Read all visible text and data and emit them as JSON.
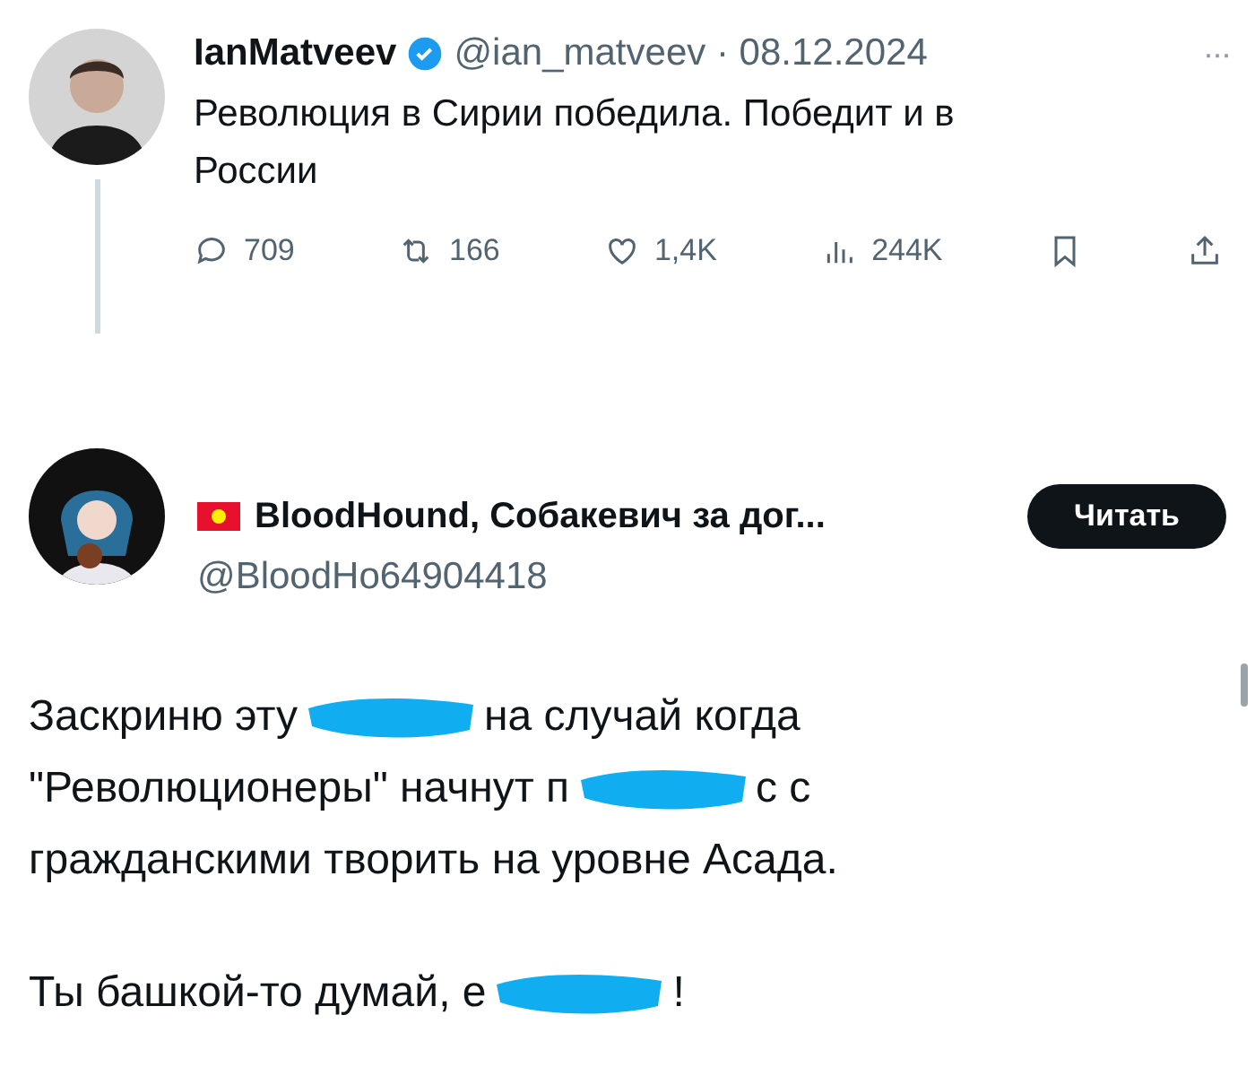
{
  "original_post": {
    "author": "IanMatveev",
    "verified": true,
    "handle": "@ian_matveev · 08.12.2024",
    "more": "···",
    "text": "Революция в Сирии победила. Победит и в России",
    "actions": [
      {
        "kind": "reply",
        "count": "709"
      },
      {
        "kind": "repost",
        "count": "166"
      },
      {
        "kind": "like",
        "count": "1,4K"
      },
      {
        "kind": "views",
        "count": "244K"
      },
      {
        "kind": "bookmark"
      },
      {
        "kind": "share"
      }
    ]
  },
  "reply_post": {
    "author": "BloodHound, Собакевич за дог...",
    "handle": "@BloodHo64904418",
    "follow_button": "Читать",
    "paragraphs": [
      [
        [
          {
            "kind": "text",
            "text": "Заскриню эту"
          },
          {
            "kind": "scribble"
          },
          {
            "kind": "text",
            "text": "на случай когда"
          }
        ],
        [
          {
            "kind": "text",
            "text": "\"Революционеры\" начнут п"
          },
          {
            "kind": "scribble"
          },
          {
            "kind": "text",
            "text": "с с"
          }
        ],
        [
          {
            "kind": "text",
            "text": "гражданскими творить на уровне Асада."
          }
        ]
      ],
      [
        [
          {
            "kind": "text",
            "text": "Ты башкой-то думай, е"
          },
          {
            "kind": "scribble"
          },
          {
            "kind": "text",
            "text": "!"
          }
        ]
      ]
    ]
  }
}
